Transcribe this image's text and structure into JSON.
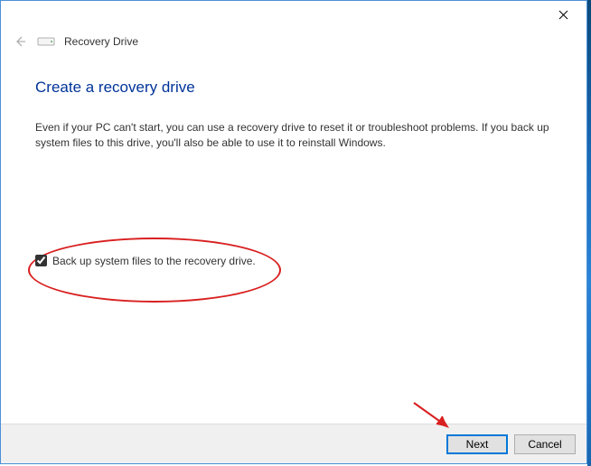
{
  "window": {
    "title": "Recovery Drive"
  },
  "page": {
    "heading": "Create a recovery drive",
    "description": "Even if your PC can't start, you can use a recovery drive to reset it or troubleshoot problems. If you back up system files to this drive, you'll also be able to use it to reinstall Windows."
  },
  "checkbox": {
    "label": "Back up system files to the recovery drive.",
    "checked": true
  },
  "buttons": {
    "next": "Next",
    "cancel": "Cancel"
  }
}
